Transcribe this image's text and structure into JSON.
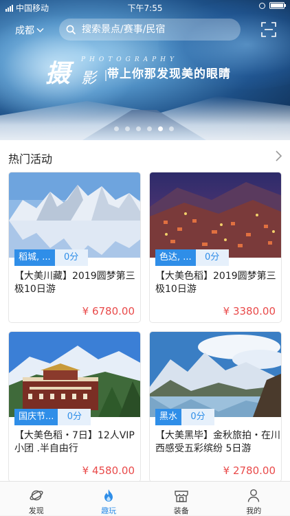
{
  "status_bar": {
    "carrier": "中国移动",
    "time": "下午7:55"
  },
  "header": {
    "city": "成都",
    "search_placeholder": "搜索景点/赛事/民宿"
  },
  "banner": {
    "title_char_1": "摄",
    "title_char_2": "影",
    "photography": "PHOTOGRAPHY",
    "slogan": "带上你那发现美的眼睛",
    "dots_total": 6,
    "dots_active_index": 4
  },
  "section": {
    "title": "热门活动"
  },
  "cards": [
    {
      "location": "稻城, ...",
      "score": "0分",
      "name": "【大美川藏】2019圆梦第三极10日游",
      "price": "¥ 6780.00"
    },
    {
      "location": "色达, ...",
      "score": "0分",
      "name": "【大美色稻】2019圆梦第三极10日游",
      "price": "¥ 3380.00"
    },
    {
      "location": "国庆节...",
      "score": "0分",
      "name": "【大美色稻・7日】12人VIP小团 .半自由行",
      "price": "¥ 4580.00"
    },
    {
      "location": "黑水",
      "score": "0分",
      "name": "【大美黑毕】金秋旅拍・在川西感受五彩缤纷 5日游",
      "price": "¥ 2780.00"
    }
  ],
  "tabs": [
    {
      "label": "发现",
      "icon": "planet-icon"
    },
    {
      "label": "趣玩",
      "icon": "flame-icon"
    },
    {
      "label": "装备",
      "icon": "store-icon"
    },
    {
      "label": "我的",
      "icon": "person-icon"
    }
  ],
  "colors": {
    "accent": "#2f8ee8",
    "price": "#e94a4a"
  }
}
